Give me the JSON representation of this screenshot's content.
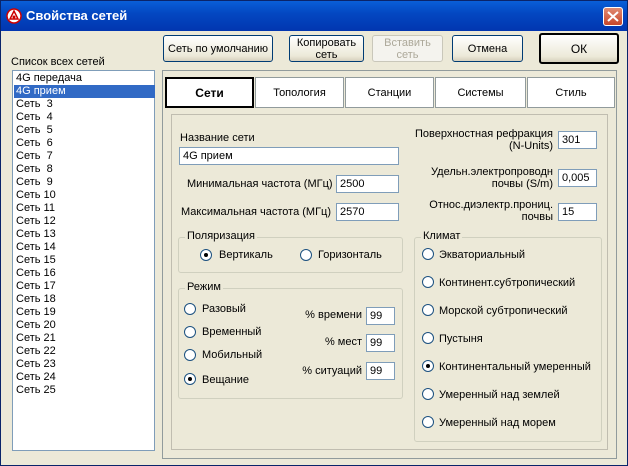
{
  "window": {
    "title": "Свойства сетей"
  },
  "list": {
    "label": "Список всех сетей",
    "items": [
      "4G передача",
      "4G прием",
      "Сеть  3",
      "Сеть  4",
      "Сеть  5",
      "Сеть  6",
      "Сеть  7",
      "Сеть  8",
      "Сеть  9",
      "Сеть 10",
      "Сеть 11",
      "Сеть 12",
      "Сеть 13",
      "Сеть 14",
      "Сеть 15",
      "Сеть 16",
      "Сеть 17",
      "Сеть 18",
      "Сеть 19",
      "Сеть 20",
      "Сеть 21",
      "Сеть 22",
      "Сеть 23",
      "Сеть 24",
      "Сеть 25"
    ],
    "selected_index": 1
  },
  "toolbar": {
    "default_label": "Сеть по умолчанию",
    "copy_label_1": "Копировать",
    "copy_label_2": "сеть",
    "paste_label_1": "Вставить",
    "paste_label_2": "сеть",
    "cancel_label": "Отмена",
    "ok_label": "ОК"
  },
  "tabs": [
    "Сети",
    "Топология",
    "Станции",
    "Системы",
    "Стиль"
  ],
  "active_tab": "Сети",
  "net": {
    "name_label": "Название сети",
    "name_value": "4G прием",
    "min_freq_label": "Минимальная частота (МГц)",
    "min_freq_value": "2500",
    "max_freq_label": "Максимальная частота (МГц)",
    "max_freq_value": "2570"
  },
  "refraction": {
    "label_1": "Поверхностная рефракция",
    "label_2": "(N-Units)",
    "value": "301"
  },
  "conductivity": {
    "label_1": "Удельн.электропроводн",
    "label_2": "почвы (S/m)",
    "value": "0,005"
  },
  "permittivity": {
    "label_1": "Относ.диэлектр.прониц.",
    "label_2": "почвы",
    "value": "15"
  },
  "polarization": {
    "label": "Поляризация",
    "options": [
      "Вертикаль",
      "Горизонталь"
    ],
    "selected": "Вертикаль"
  },
  "mode": {
    "label": "Режим",
    "options": [
      "Разовый",
      "Временный",
      "Мобильный",
      "Вещание"
    ],
    "selected": "Вещание",
    "time_label": "% времени",
    "time_value": "99",
    "places_label": "% мест",
    "places_value": "99",
    "situations_label": "% ситуаций",
    "situations_value": "99"
  },
  "climate": {
    "label": "Климат",
    "options": [
      "Экваториальный",
      "Континент.субтропический",
      "Морской субтропический",
      "Пустыня",
      "Континентальный умеренный",
      "Умеренный над землей",
      "Умеренный над морем"
    ],
    "selected": "Континентальный умеренный"
  },
  "colors": {
    "title_bar": "#0348c2",
    "selection": "#316ac5",
    "dialog_bg": "#ece9d8"
  },
  "icons": {
    "app": "network-properties-icon",
    "close": "close-icon"
  }
}
